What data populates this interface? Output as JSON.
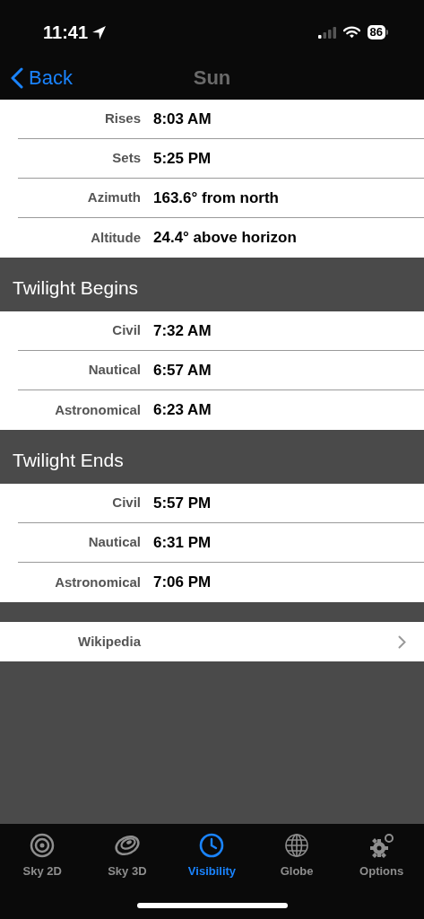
{
  "status_bar": {
    "time": "11:41",
    "battery": "86"
  },
  "nav": {
    "back": "Back",
    "title": "Sun"
  },
  "sections": [
    {
      "rows": [
        {
          "label": "Rises",
          "value": "8:03 AM"
        },
        {
          "label": "Sets",
          "value": "5:25 PM"
        },
        {
          "label": "Azimuth",
          "value": "163.6° from north"
        },
        {
          "label": "Altitude",
          "value": "24.4° above horizon"
        }
      ]
    },
    {
      "title": "Twilight Begins",
      "rows": [
        {
          "label": "Civil",
          "value": "7:32 AM"
        },
        {
          "label": "Nautical",
          "value": "6:57 AM"
        },
        {
          "label": "Astronomical",
          "value": "6:23 AM"
        }
      ]
    },
    {
      "title": "Twilight Ends",
      "rows": [
        {
          "label": "Civil",
          "value": "5:57 PM"
        },
        {
          "label": "Nautical",
          "value": "6:31 PM"
        },
        {
          "label": "Astronomical",
          "value": "7:06 PM"
        }
      ]
    }
  ],
  "link": {
    "label": "Wikipedia"
  },
  "tabs": [
    {
      "kind": "sky2d",
      "label": "Sky 2D",
      "selected": false
    },
    {
      "kind": "sky3d",
      "label": "Sky 3D",
      "selected": false
    },
    {
      "kind": "clock",
      "label": "Visibility",
      "selected": true
    },
    {
      "kind": "globe",
      "label": "Globe",
      "selected": false
    },
    {
      "kind": "gear",
      "label": "Options",
      "selected": false
    }
  ]
}
